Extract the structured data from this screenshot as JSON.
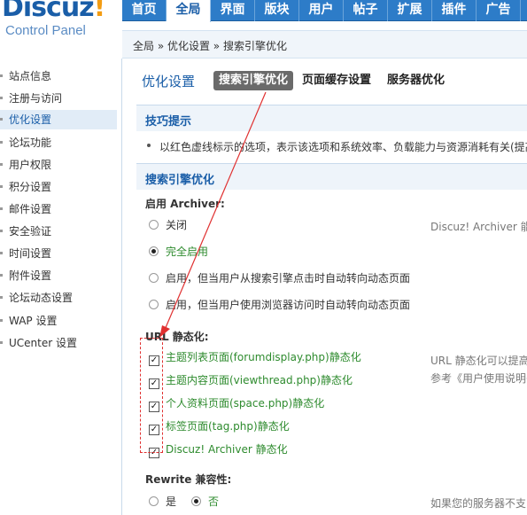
{
  "logo": {
    "main": "Discuz",
    "bang": "!",
    "sub": "Control Panel"
  },
  "nav": {
    "items": [
      "首页",
      "全局",
      "界面",
      "版块",
      "用户",
      "帖子",
      "扩展",
      "插件",
      "广告"
    ],
    "active": "全局"
  },
  "breadcrumb": "全局 » 优化设置 » 搜索引擎优化",
  "sidebar": {
    "items": [
      "站点信息",
      "注册与访问",
      "优化设置",
      "论坛功能",
      "用户权限",
      "积分设置",
      "邮件设置",
      "安全验证",
      "时间设置",
      "附件设置",
      "论坛动态设置",
      "WAP 设置",
      "UCenter 设置"
    ],
    "active": "优化设置"
  },
  "main": {
    "title": "优化设置",
    "tabs": [
      "搜索引擎优化",
      "页面缓存设置",
      "服务器优化"
    ],
    "active_tab": "搜索引擎优化",
    "tips_header": "技巧提示",
    "tip": "以红色虚线标示的选项，表示该选项和系统效率、负载能力与资源消耗有关(提高",
    "seo_header": "搜索引擎优化",
    "archiver": {
      "label": "启用  Archiver:",
      "options": [
        "关闭",
        "完全启用",
        "启用，但当用户从搜索引擎点击时自动转向动态页面",
        "启用，但当用户使用浏览器访问时自动转向动态页面"
      ],
      "selected": "完全启用",
      "note": "Discuz! Archiver 能"
    },
    "url_static": {
      "label": "URL 静态化:",
      "options": [
        "主题列表页面(forumdisplay.php)静态化",
        "主题内容页面(viewthread.php)静态化",
        "个人资料页面(space.php)静态化",
        "标签页面(tag.php)静态化",
        "Discuz! Archiver 静态化"
      ],
      "checked": [
        true,
        true,
        true,
        true,
        true
      ],
      "note1": "URL 静态化可以提高",
      "note2": "参考《用户使用说明书"
    },
    "rewrite": {
      "label": "Rewrite 兼容性:",
      "options": [
        "是",
        "否"
      ],
      "selected": "否",
      "note": "如果您的服务器不支"
    }
  },
  "colors": {
    "accent": "#2d7cc8",
    "brand": "#1a5ea8",
    "highlight": "#e03030",
    "option_green": "#2e8b2e"
  }
}
